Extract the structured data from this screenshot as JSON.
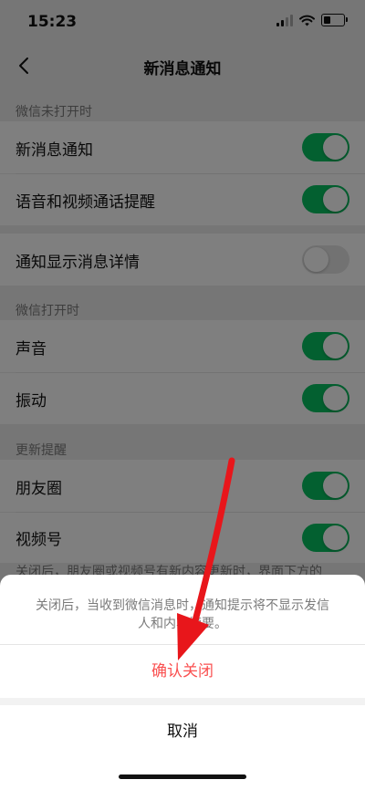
{
  "status": {
    "time": "15:23"
  },
  "nav": {
    "title": "新消息通知"
  },
  "sections": [
    {
      "title": "微信未打开时",
      "items": [
        {
          "label": "新消息通知",
          "on": true
        },
        {
          "label": "语音和视频通话提醒",
          "on": true
        }
      ]
    },
    {
      "title": "",
      "items": [
        {
          "label": "通知显示消息详情",
          "on": false
        }
      ]
    },
    {
      "title": "微信打开时",
      "items": [
        {
          "label": "声音",
          "on": true
        },
        {
          "label": "振动",
          "on": true
        }
      ]
    },
    {
      "title": "更新提醒",
      "items": [
        {
          "label": "朋友圈",
          "on": true
        },
        {
          "label": "视频号",
          "on": true
        }
      ]
    }
  ],
  "footer_note": "关闭后，朋友圈或视频号有新内容更新时，界面下方的",
  "sheet": {
    "description": "关闭后，当收到微信消息时，通知提示将不显示发信人和内容摘要。",
    "confirm_label": "确认关闭",
    "cancel_label": "取消"
  },
  "colors": {
    "switch_on": "#07c160",
    "danger": "#fa5151",
    "annotation_arrow": "#e8161b"
  },
  "icons": [
    "back-icon",
    "signal-icon",
    "wifi-icon",
    "battery-icon"
  ]
}
